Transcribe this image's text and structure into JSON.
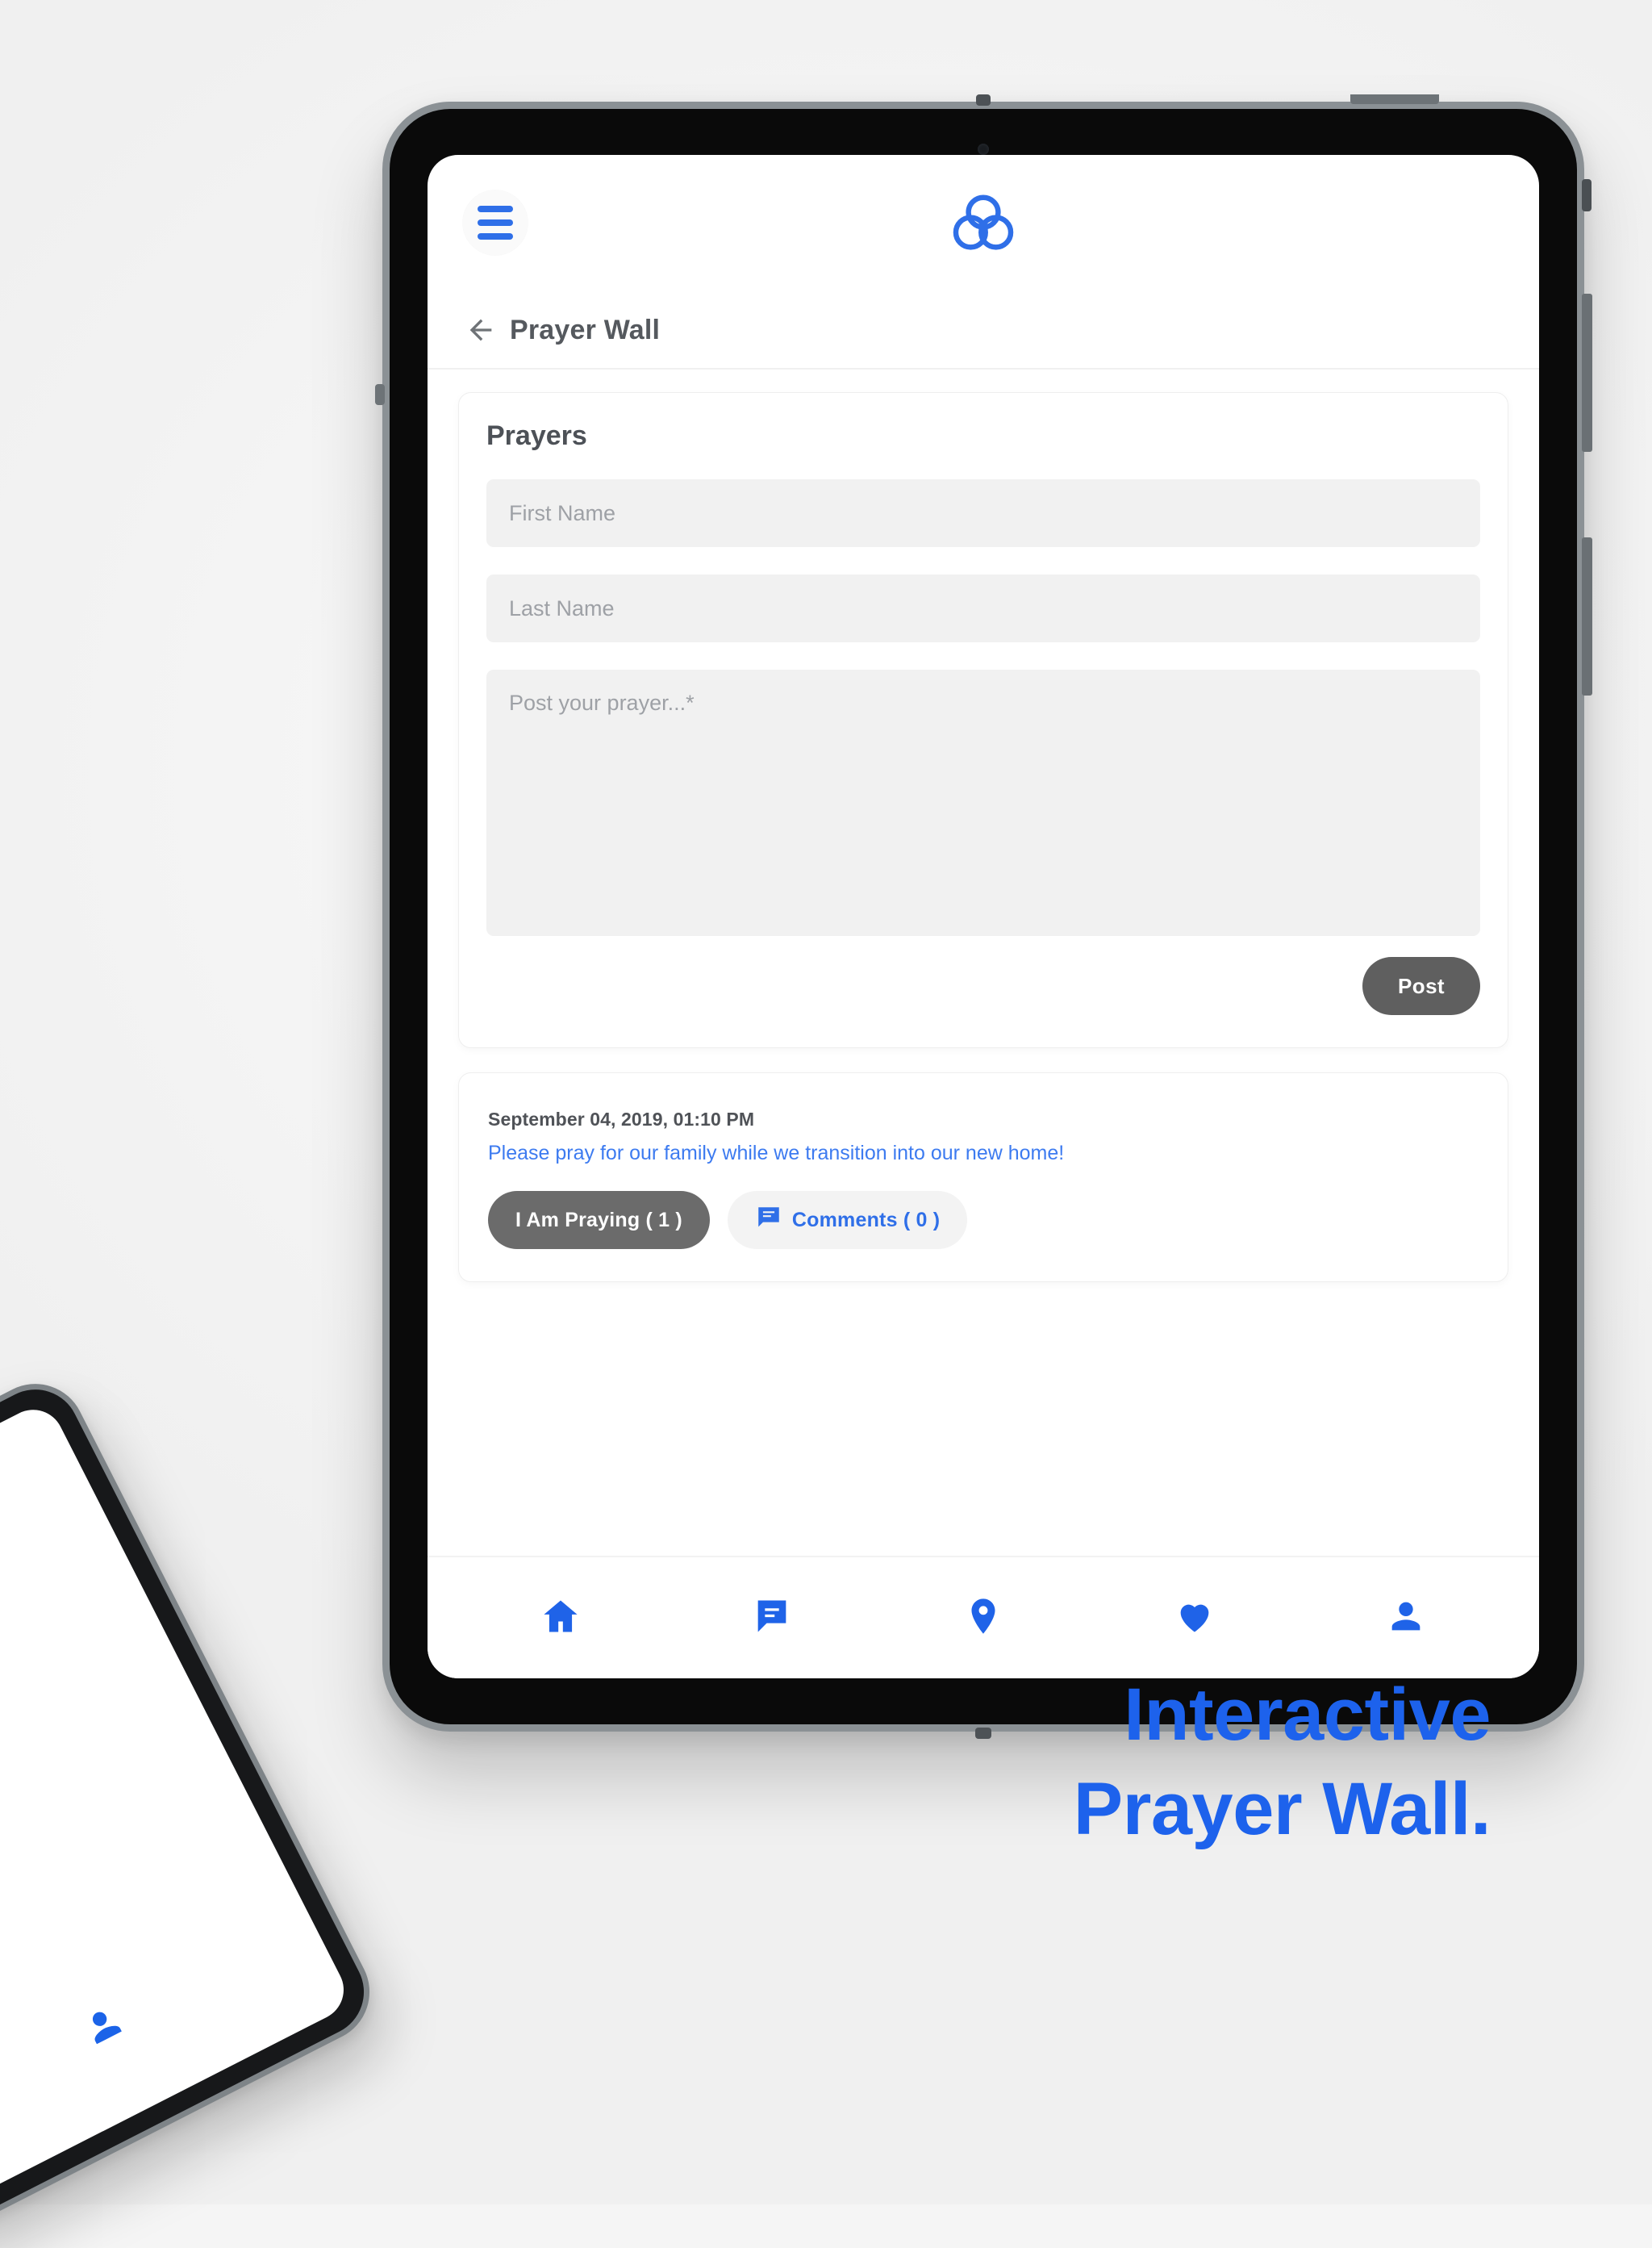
{
  "colors": {
    "brand_blue": "#1d62ec",
    "app_blue": "#2f6fe8",
    "post_text_blue": "#3d7bf0",
    "dark_pill": "#6b6b6b",
    "post_button": "#5f5f5f",
    "page_background": "#f5f5f5",
    "field_background": "#f1f1f1"
  },
  "appbar": {
    "menu_icon": "hamburger-menu-icon",
    "logo_icon": "trinity-knot-logo"
  },
  "page_header": {
    "back_icon": "arrow-left-icon",
    "title": "Prayer Wall"
  },
  "prayer_form": {
    "title": "Prayers",
    "first_name": {
      "value": "",
      "placeholder": "First Name"
    },
    "last_name": {
      "value": "",
      "placeholder": "Last Name"
    },
    "prayer_body": {
      "value": "",
      "placeholder": "Post your prayer...*"
    },
    "submit_label": "Post"
  },
  "prayer_posts": [
    {
      "timestamp": "September 04, 2019, 01:10 PM",
      "text": "Please pray for our family while we transition into our new home!",
      "praying_label": "I Am Praying ( 1 )",
      "praying_count": 1,
      "comments_label": "Comments ( 0 )",
      "comments_count": 0,
      "comments_icon": "chat-bubble-icon"
    }
  ],
  "bottom_nav": {
    "items": [
      {
        "name": "home",
        "icon": "home-icon"
      },
      {
        "name": "messages",
        "icon": "chat-bubble-icon"
      },
      {
        "name": "locations",
        "icon": "map-pin-icon"
      },
      {
        "name": "favorites",
        "icon": "heart-icon"
      },
      {
        "name": "profile",
        "icon": "person-icon"
      }
    ]
  },
  "caption": {
    "line1": "Interactive",
    "line2": "Prayer Wall."
  }
}
